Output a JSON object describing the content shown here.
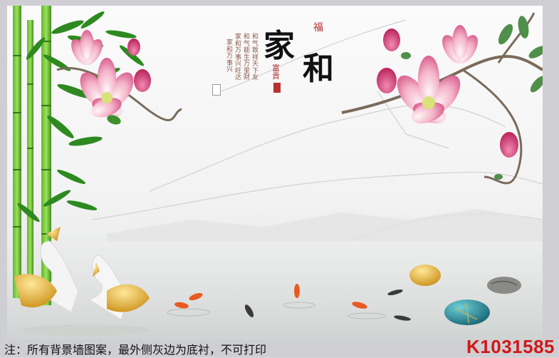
{
  "calligraphy": {
    "main_title": "家和",
    "fu_char": "福",
    "fugui_text": "富貴",
    "poem_columns": [
      "和气致祥天下友",
      "和气能生万里财",
      "家和万事兴旺达"
    ],
    "poem_signature": "家和万事兴"
  },
  "footer": {
    "note": "注：所有背景墙图案，最外侧灰边为底衬，不可打印",
    "product_code": "K1031585"
  },
  "colors": {
    "code_red": "#d01818",
    "seal_red": "#b83030",
    "bamboo_green": "#3b9a2a",
    "magnolia_pink": "#e88bb0"
  }
}
